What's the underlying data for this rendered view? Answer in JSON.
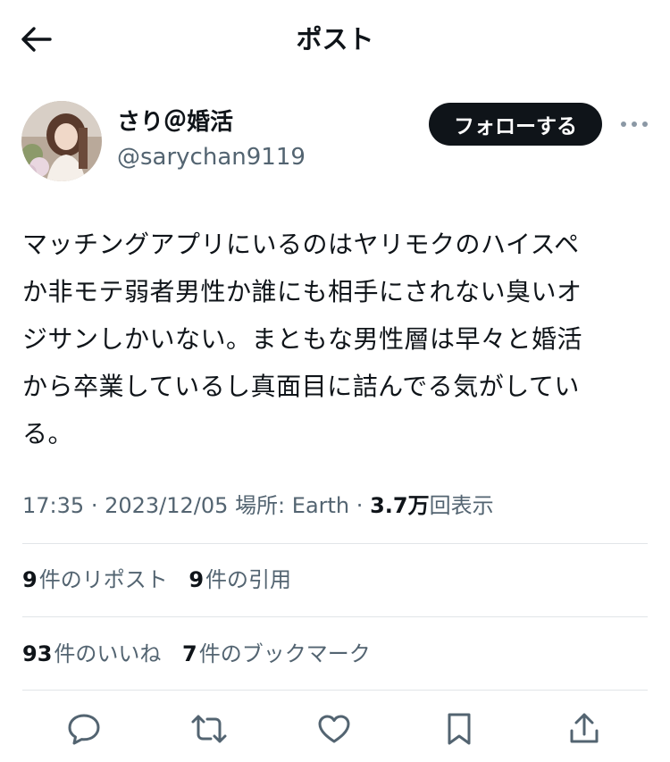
{
  "header": {
    "title": "ポスト"
  },
  "author": {
    "display_name": "さり＠婚活",
    "handle": "@sarychan9119",
    "follow_label": "フォローする"
  },
  "tweet": {
    "text": "マッチングアプリにいるのはヤリモクのハイスペ\nか非モテ弱者男性か誰にも相手にされない臭いオ\nジサンしかいない。まともな男性層は早々と婚活\nから卒業しているし真面目に詰んでる気がしてい\nる。"
  },
  "meta": {
    "time": "17:35",
    "date": "2023/12/05",
    "separator": "·",
    "location_label": "場所: Earth",
    "views_count": "3.7万",
    "views_label": "回表示"
  },
  "stats": {
    "reposts": {
      "count": "9",
      "label": "件のリポスト"
    },
    "quotes": {
      "count": "9",
      "label": "件の引用"
    },
    "likes": {
      "count": "93",
      "label": "件のいいね"
    },
    "bookmarks": {
      "count": "7",
      "label": "件のブックマーク"
    }
  },
  "icons": {
    "back": "back-arrow-icon",
    "more": "more-icon",
    "reply": "reply-icon",
    "repost": "repost-icon",
    "like": "heart-icon",
    "bookmark": "bookmark-icon",
    "share": "share-icon"
  },
  "colors": {
    "text": "#0f1419",
    "secondary": "#536471",
    "divider": "#e1e5e8",
    "button": "#0f1419"
  }
}
